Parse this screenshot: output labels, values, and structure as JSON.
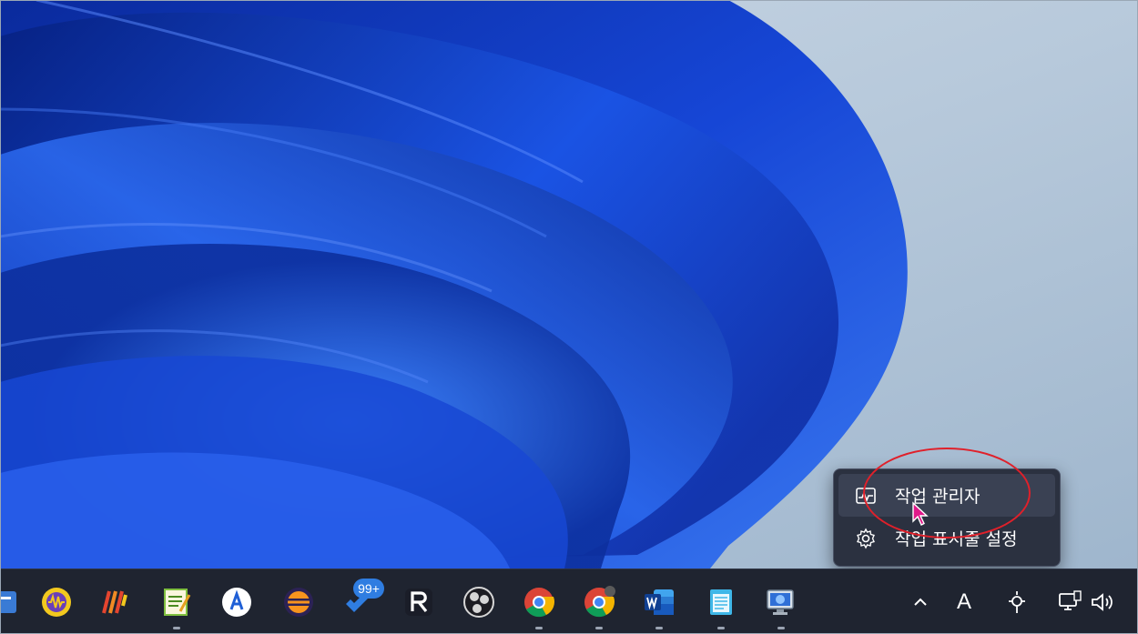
{
  "context_menu": {
    "items": [
      {
        "label": "작업 관리자",
        "icon": "task-manager-icon",
        "hover": true
      },
      {
        "label": "작업 표시줄 설정",
        "icon": "gear-icon",
        "hover": false
      }
    ]
  },
  "annotation": {
    "color": "#e0202a"
  },
  "cursor": {
    "color": "#e0188a"
  },
  "taskbar": {
    "apps": [
      {
        "icon": "partial-app-icon",
        "running": false
      },
      {
        "icon": "audio-wave-app-icon",
        "running": false
      },
      {
        "icon": "stripes-app-icon",
        "running": false
      },
      {
        "icon": "notepad-editor-icon",
        "running": true
      },
      {
        "icon": "circle-a-app-icon",
        "running": false
      },
      {
        "icon": "eclipse-ide-icon",
        "running": false
      },
      {
        "icon": "todo-app-icon",
        "running": false,
        "badge": "99+"
      },
      {
        "icon": "r-app-icon",
        "running": false
      },
      {
        "icon": "obs-studio-icon",
        "running": false
      },
      {
        "icon": "chrome-icon",
        "running": true
      },
      {
        "icon": "chrome-profile-icon",
        "running": true
      },
      {
        "icon": "word-icon",
        "running": true
      },
      {
        "icon": "notes-app-icon",
        "running": true
      },
      {
        "icon": "remote-desktop-icon",
        "running": true
      }
    ],
    "tray": {
      "overflow_chevron": "^",
      "input_mode": "A",
      "brightness_icon": "brightness-icon",
      "network_icon": "network-icon",
      "volume_icon": "volume-icon"
    }
  },
  "colors": {
    "taskbar_bg": "#1f2430",
    "menu_bg": "#2b3140",
    "accent_blue": "#1d4fd8"
  }
}
